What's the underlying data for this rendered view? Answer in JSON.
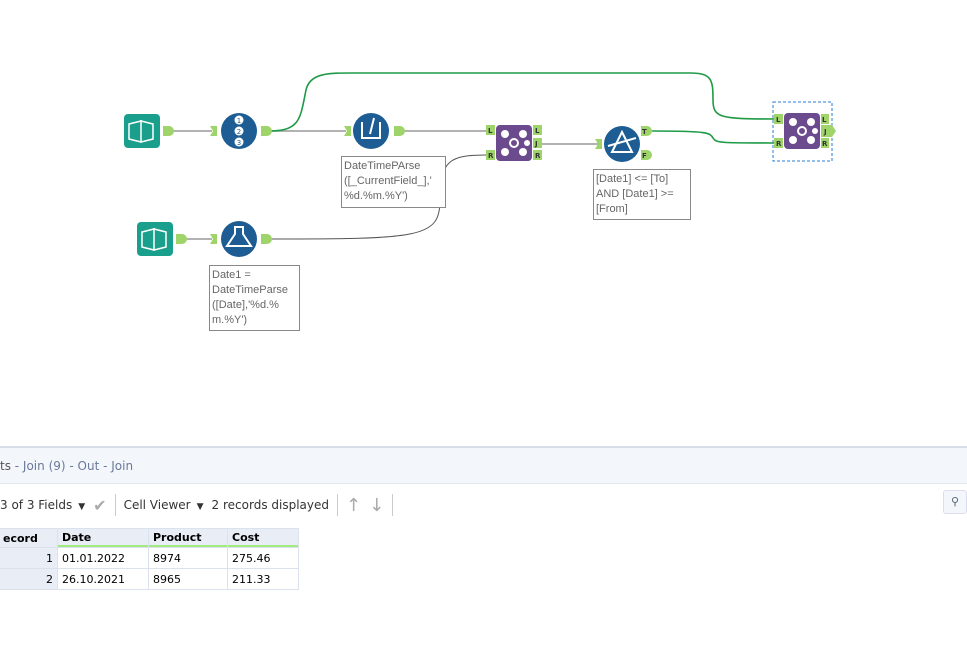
{
  "canvas": {
    "annotations": {
      "multi_field": "DateTimePArse\n([_CurrentField_],'\n%d.%m.%Y')",
      "formula": "Date1 =\nDateTimeParse\n([Date],'%d.%\nm.%Y')",
      "filter": "[Date1] <= [To]\nAND [Date1] >=\n[From]"
    },
    "anchors": {
      "L": "L",
      "R": "R",
      "J": "J",
      "T": "T",
      "F": "F"
    },
    "colors": {
      "input": "#1a9f8c",
      "blue_tool": "#1d5d94",
      "join": "#6b4a8e",
      "anchor": "#9fd46a",
      "selected_wire": "#1f9a47"
    }
  },
  "results": {
    "title_prefix": "ts",
    "title_path": " - Join (9) - Out - Join",
    "fields_label": "3 of 3 Fields",
    "cell_viewer_label": "Cell Viewer",
    "records_label": "2 records displayed",
    "columns": [
      "ecord",
      "Date",
      "Product",
      "Cost"
    ],
    "rows": [
      [
        "1",
        "01.01.2022",
        "8974",
        "275.46"
      ],
      [
        "2",
        "26.10.2021",
        "8965",
        "211.33"
      ]
    ]
  }
}
